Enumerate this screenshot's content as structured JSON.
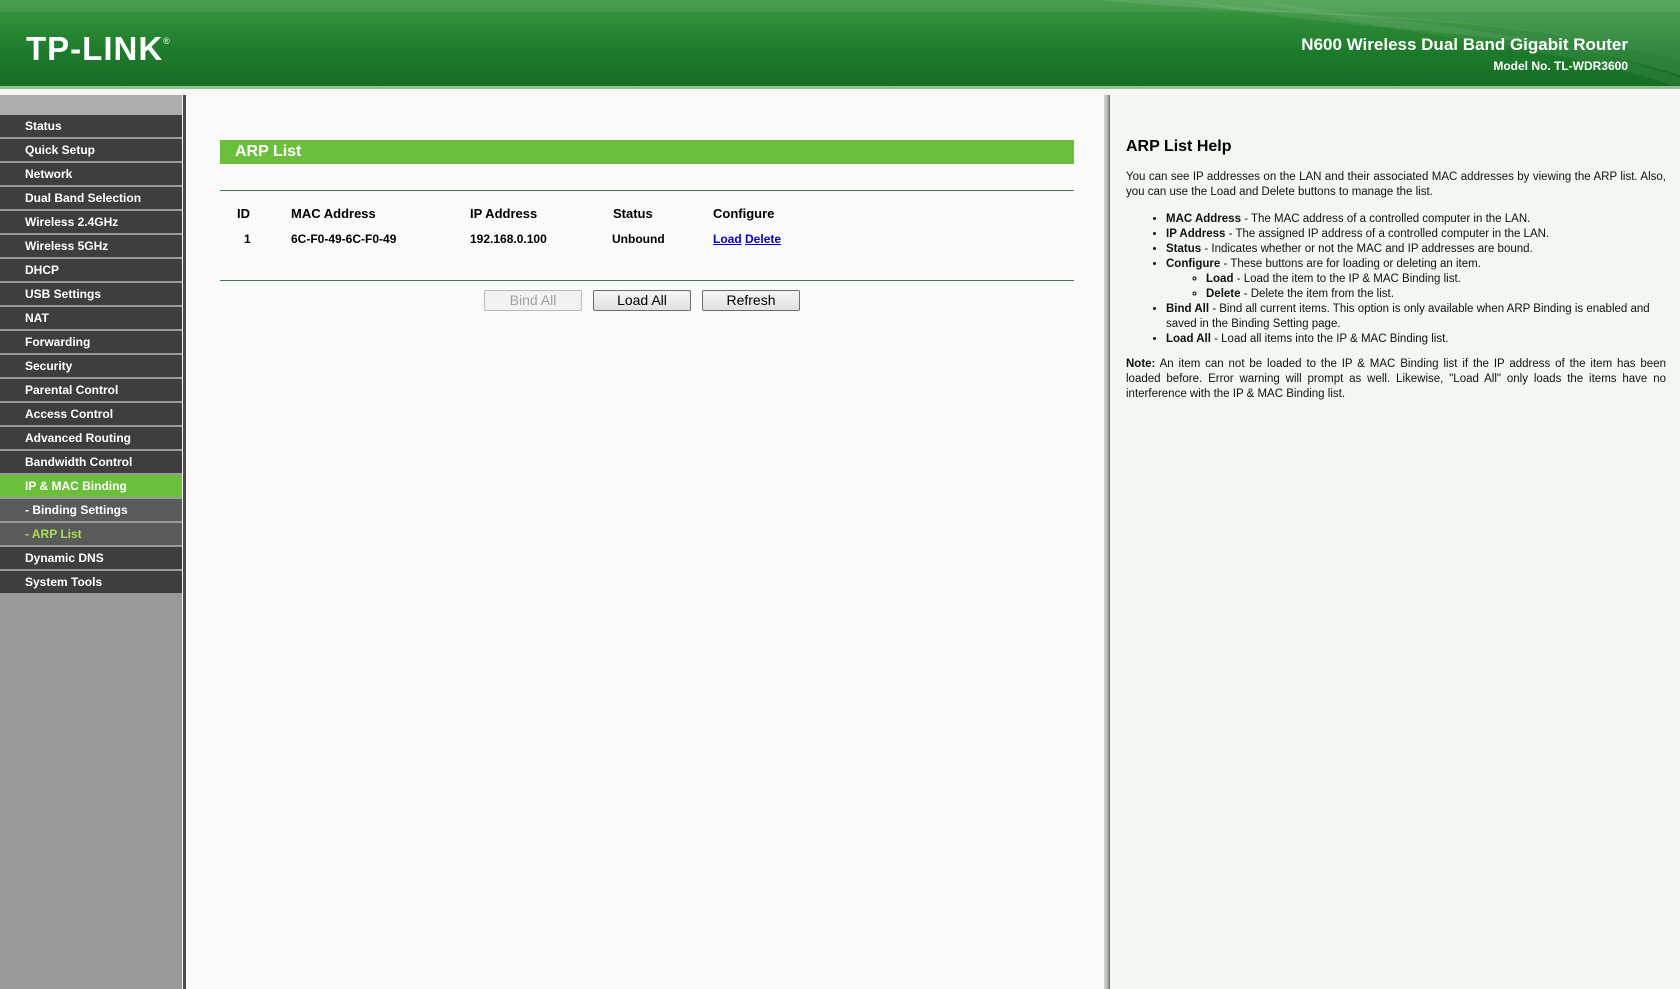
{
  "header": {
    "logo": "TP-LINK",
    "logo_mark": "®",
    "product_name": "N600 Wireless Dual Band Gigabit Router",
    "model_no": "Model No. TL-WDR3600"
  },
  "sidebar": {
    "items": [
      {
        "label": "Status",
        "state": "normal"
      },
      {
        "label": "Quick Setup",
        "state": "normal"
      },
      {
        "label": "Network",
        "state": "normal"
      },
      {
        "label": "Dual Band Selection",
        "state": "normal"
      },
      {
        "label": "Wireless 2.4GHz",
        "state": "normal"
      },
      {
        "label": "Wireless 5GHz",
        "state": "normal"
      },
      {
        "label": "DHCP",
        "state": "normal"
      },
      {
        "label": "USB Settings",
        "state": "normal"
      },
      {
        "label": "NAT",
        "state": "normal"
      },
      {
        "label": "Forwarding",
        "state": "normal"
      },
      {
        "label": "Security",
        "state": "normal"
      },
      {
        "label": "Parental Control",
        "state": "normal"
      },
      {
        "label": "Access Control",
        "state": "normal"
      },
      {
        "label": "Advanced Routing",
        "state": "normal"
      },
      {
        "label": "Bandwidth Control",
        "state": "normal"
      },
      {
        "label": "IP & MAC Binding",
        "state": "active"
      },
      {
        "label": "- Binding Settings",
        "state": "sub"
      },
      {
        "label": "- ARP List",
        "state": "sub-active"
      },
      {
        "label": "Dynamic DNS",
        "state": "normal"
      },
      {
        "label": "System Tools",
        "state": "normal"
      }
    ]
  },
  "main": {
    "title": "ARP List",
    "table": {
      "headers": [
        "ID",
        "MAC Address",
        "IP Address",
        "Status",
        "Configure"
      ],
      "rows": [
        {
          "id": "1",
          "mac": "6C-F0-49-6C-F0-49",
          "ip": "192.168.0.100",
          "status": "Unbound",
          "load": "Load",
          "delete": "Delete"
        }
      ]
    },
    "buttons": {
      "bind_all": "Bind All",
      "load_all": "Load All",
      "refresh": "Refresh"
    }
  },
  "help": {
    "title": "ARP List Help",
    "intro": "You can see IP addresses on the LAN and their associated MAC addresses by viewing the ARP list. Also, you can use the Load and Delete buttons to manage the list.",
    "items": {
      "mac_term": "MAC Address",
      "mac_desc": " - The MAC address of a controlled computer in the LAN.",
      "ip_term": "IP Address",
      "ip_desc": " - The assigned IP address of a controlled computer in the LAN.",
      "status_term": "Status",
      "status_desc": " - Indicates whether or not the MAC and IP addresses are bound.",
      "configure_term": "Configure",
      "configure_desc": " - These buttons are for loading or deleting an item.",
      "load_term": "Load",
      "load_desc": " - Load the item to the IP & MAC Binding list.",
      "delete_term": "Delete",
      "delete_desc": " - Delete the item from the list.",
      "bindall_term": "Bind All",
      "bindall_desc": " - Bind all current items. This option is only available when ARP Binding is enabled and saved in the Binding Setting page.",
      "loadall_term": "Load All",
      "loadall_desc": " - Load all items into the IP & MAC Binding list."
    },
    "note_term": "Note:",
    "note_desc": " An item can not be loaded to the IP & MAC Binding list if the IP address of the item has been loaded before. Error warning will prompt as well. Likewise, \"Load All\" only loads the items have no interference with the IP & MAC Binding list."
  },
  "colors": {
    "header_green": "#1d7a2b",
    "accent_green": "#6bbf3a",
    "nav_dark": "#3e3e3e",
    "sub_active_text": "#a6e05a",
    "link_blue": "#0000cc"
  }
}
